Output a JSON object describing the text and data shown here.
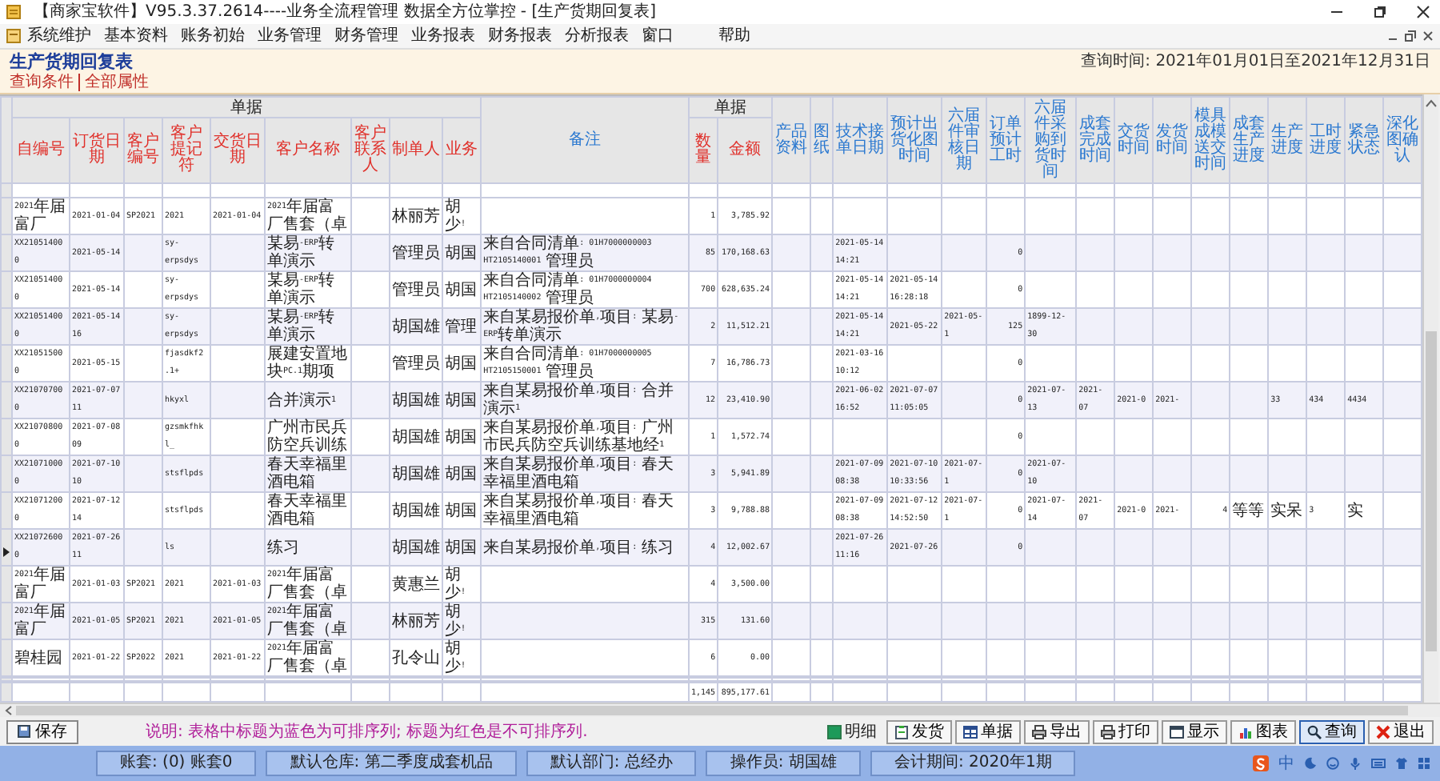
{
  "window": {
    "title": "【商家宝软件】V95.3.37.2614----业务全流程管理 数据全方位掌控 - [生产货期回复表]"
  },
  "menu": [
    "系统维护",
    "基本资料",
    "账务初始",
    "业务管理",
    "财务管理",
    "业务报表",
    "财务报表",
    "分析报表",
    "窗口",
    "帮助"
  ],
  "report": {
    "title": "生产货期回复表",
    "query_time": "查询时间: 2021年01月01日至2021年12月31日",
    "links": [
      "查询条件",
      "全部属性"
    ]
  },
  "table": {
    "groups": [
      {
        "label": "单据"
      },
      {
        "label": "单据"
      }
    ],
    "columns": [
      {
        "label": "自编号",
        "sortable": false
      },
      {
        "label": "订货日期",
        "sortable": false
      },
      {
        "label": "客户编号",
        "sortable": false
      },
      {
        "label": "客户提记符",
        "sortable": false
      },
      {
        "label": "交货日期",
        "sortable": false
      },
      {
        "label": "客户名称",
        "sortable": false
      },
      {
        "label": "客户联系人",
        "sortable": false
      },
      {
        "label": "制单人",
        "sortable": false
      },
      {
        "label": "业务",
        "sortable": false
      },
      {
        "label": "备注",
        "sortable": true
      },
      {
        "label": "数量",
        "sortable": false,
        "kind": "number"
      },
      {
        "label": "金额",
        "sortable": false,
        "kind": "number"
      },
      {
        "label": "产品资料",
        "sortable": true
      },
      {
        "label": "图纸",
        "sortable": true
      },
      {
        "label": "技术接单日期",
        "sortable": true
      },
      {
        "label": "预计出货化图时间",
        "sortable": true
      },
      {
        "label": "六届件审核日期",
        "sortable": true
      },
      {
        "label": "订单预计工时",
        "sortable": true,
        "kind": "number"
      },
      {
        "label": "六届件采购到货时间",
        "sortable": true
      },
      {
        "label": "成套完成时间",
        "sortable": true
      },
      {
        "label": "交货时间",
        "sortable": true
      },
      {
        "label": "发货时间",
        "sortable": true
      },
      {
        "label": "模具成模送交时间",
        "sortable": true,
        "kind": "number"
      },
      {
        "label": "成套生产进度",
        "sortable": true
      },
      {
        "label": "生产进度",
        "sortable": true
      },
      {
        "label": "工时进度",
        "sortable": true
      },
      {
        "label": "紧急状态",
        "sortable": true
      },
      {
        "label": "深化图确认",
        "sortable": true
      }
    ],
    "rows": [
      {
        "current": false,
        "cells": [
          "2021年届富厂",
          "2021-01-04",
          "SP2021",
          "2021",
          "2021-01-04",
          "2021年届富厂售套（卓",
          null,
          "林丽芳",
          "胡少!",
          null,
          "1",
          "3,785.92",
          null,
          null,
          null,
          null,
          null,
          null,
          null,
          null,
          null,
          null,
          null,
          null,
          null,
          null,
          null,
          null
        ]
      },
      {
        "current": false,
        "cells": [
          "XX210514000",
          "2021-05-14",
          null,
          "sy-erpsdys",
          null,
          "某易-ERP转单演示",
          null,
          "管理员",
          "胡国",
          "来自合同清单: 01H7000000003 HT2105140001 管理员",
          "85",
          "170,168.63",
          null,
          null,
          "2021-05-14 14:21",
          null,
          null,
          "0",
          null,
          null,
          null,
          null,
          null,
          null,
          null,
          null,
          null,
          null
        ]
      },
      {
        "current": false,
        "cells": [
          "XX210514000",
          "2021-05-14",
          null,
          "sy-erpsdys",
          null,
          "某易-ERP转单演示",
          null,
          "管理员",
          "胡国",
          "来自合同清单: 01H7000000004 HT2105140002 管理员",
          "700",
          "628,635.24",
          null,
          null,
          "2021-05-14 14:21",
          "2021-05-14 16:28:18",
          null,
          "0",
          null,
          null,
          null,
          null,
          null,
          null,
          null,
          null,
          null,
          null
        ]
      },
      {
        "current": false,
        "cells": [
          "XX210514000",
          "2021-05-14 16",
          null,
          "sy-erpsdys",
          null,
          "某易-ERP转单演示",
          null,
          "胡国雄",
          "管理",
          "来自某易报价单,项目: 某易-ERP转单演示",
          "2",
          "11,512.21",
          null,
          null,
          "2021-05-14 14:21",
          "2021-05-22",
          "2021-05-1",
          "125",
          "1899-12-30",
          null,
          null,
          null,
          null,
          null,
          null,
          null,
          null,
          null
        ]
      },
      {
        "current": false,
        "cells": [
          "XX210515000",
          "2021-05-15",
          null,
          "fjasdkf2.1+",
          null,
          "展建安置地块PC.1期项",
          null,
          "管理员",
          "胡国",
          "来自合同清单: 01H7000000005 HT2105150001 管理员",
          "7",
          "16,786.73",
          null,
          null,
          "2021-03-16 10:12",
          null,
          null,
          "0",
          null,
          null,
          null,
          null,
          null,
          null,
          null,
          null,
          null,
          null
        ]
      },
      {
        "current": false,
        "cells": [
          "XX210707000",
          "2021-07-07 11",
          null,
          "hkyxl",
          null,
          "合并演示1",
          null,
          "胡国雄",
          "胡国",
          "来自某易报价单,项目: 合并演示1",
          "12",
          "23,410.90",
          null,
          null,
          "2021-06-02 16:52",
          "2021-07-07 11:05:05",
          null,
          "0",
          "2021-07-13",
          "2021-07",
          "2021-0",
          "2021-",
          null,
          null,
          "33",
          "434",
          "4434",
          null
        ]
      },
      {
        "current": false,
        "cells": [
          "XX210708000",
          "2021-07-08 09",
          null,
          "gzsmkfhkl_",
          null,
          "广州市民兵防空兵训练",
          null,
          "胡国雄",
          "胡国",
          "来自某易报价单,项目: 广州市民兵防空兵训练基地经1",
          "1",
          "1,572.74",
          null,
          null,
          null,
          null,
          null,
          "0",
          null,
          null,
          null,
          null,
          null,
          null,
          null,
          null,
          null,
          null
        ]
      },
      {
        "current": false,
        "cells": [
          "XX210710000",
          "2021-07-10 10",
          null,
          "stsflpds",
          null,
          "春天幸福里酒电箱",
          null,
          "胡国雄",
          "胡国",
          "来自某易报价单,项目: 春天幸福里酒电箱",
          "3",
          "5,941.89",
          null,
          null,
          "2021-07-09 08:38",
          "2021-07-10 10:33:56",
          "2021-07-1",
          "0",
          "2021-07-10",
          null,
          null,
          null,
          null,
          null,
          null,
          null,
          null,
          null
        ]
      },
      {
        "current": false,
        "cells": [
          "XX210712000",
          "2021-07-12 14",
          null,
          "stsflpds",
          null,
          "春天幸福里酒电箱",
          null,
          "胡国雄",
          "胡国",
          "来自某易报价单,项目: 春天幸福里酒电箱",
          "3",
          "9,788.88",
          null,
          null,
          "2021-07-09 08:38",
          "2021-07-12 14:52:50",
          "2021-07-1",
          "0",
          "2021-07-14",
          "2021-07",
          "2021-0",
          "2021-",
          "4",
          "等等",
          "实呆",
          "3",
          "实",
          null
        ]
      },
      {
        "current": true,
        "cells": [
          "XX210726000",
          "2021-07-26 11",
          null,
          "ls",
          null,
          "练习",
          null,
          "胡国雄",
          "胡国",
          "来自某易报价单,项目: 练习",
          "4",
          "12,002.67",
          null,
          null,
          "2021-07-26 11:16",
          "2021-07-26",
          null,
          "0",
          null,
          null,
          null,
          null,
          null,
          null,
          null,
          null,
          null,
          null
        ]
      },
      {
        "current": false,
        "cells": [
          "2021年届富厂",
          "2021-01-03",
          "SP2021",
          "2021",
          "2021-01-03",
          "2021年届富厂售套（卓",
          null,
          "黄惠兰",
          "胡少!",
          null,
          "4",
          "3,500.00",
          null,
          null,
          null,
          null,
          null,
          null,
          null,
          null,
          null,
          null,
          null,
          null,
          null,
          null,
          null,
          null
        ]
      },
      {
        "current": false,
        "cells": [
          "2021年届富厂",
          "2021-01-05",
          "SP2021",
          "2021",
          "2021-01-05",
          "2021年届富厂售套（卓",
          null,
          "林丽芳",
          "胡少!",
          null,
          "315",
          "131.60",
          null,
          null,
          null,
          null,
          null,
          null,
          null,
          null,
          null,
          null,
          null,
          null,
          null,
          null,
          null,
          null
        ]
      },
      {
        "current": false,
        "cells": [
          "碧桂园",
          "2021-01-22",
          "SP2022",
          "2021",
          "2021-01-22",
          "2021年届富厂售套（卓",
          null,
          "孔令山",
          "胡少!",
          null,
          "6",
          "0.00",
          null,
          null,
          null,
          null,
          null,
          null,
          null,
          null,
          null,
          null,
          null,
          null,
          null,
          null,
          null,
          null
        ]
      }
    ],
    "totals": {
      "qty": "1,145",
      "amount": "895,177.61"
    }
  },
  "toolbar": {
    "save": "保存",
    "note": "说明: 表格中标题为蓝色为可排序列; 标题为红色是不可排序列.",
    "detail": {
      "label": "明细",
      "checked": true
    },
    "actions": [
      {
        "label": "发货",
        "kind": "clipboard",
        "focused": false
      },
      {
        "label": "单据",
        "kind": "table",
        "focused": false
      },
      {
        "label": "导出",
        "kind": "printer",
        "focused": false
      },
      {
        "label": "打印",
        "kind": "printer",
        "focused": false
      },
      {
        "label": "显示",
        "kind": "window",
        "focused": false
      },
      {
        "label": "图表",
        "kind": "chart",
        "focused": false
      },
      {
        "label": "查询",
        "kind": "search",
        "focused": true
      },
      {
        "label": "退出",
        "kind": "exit",
        "focused": false
      }
    ]
  },
  "status_bar": [
    "账套: (0) 账套0",
    "默认仓库: 第二季度成套机品",
    "默认部门: 总经办",
    "操作员: 胡国雄",
    "会计期间: 2020年1期"
  ],
  "tray": {
    "ime_label": "中"
  }
}
